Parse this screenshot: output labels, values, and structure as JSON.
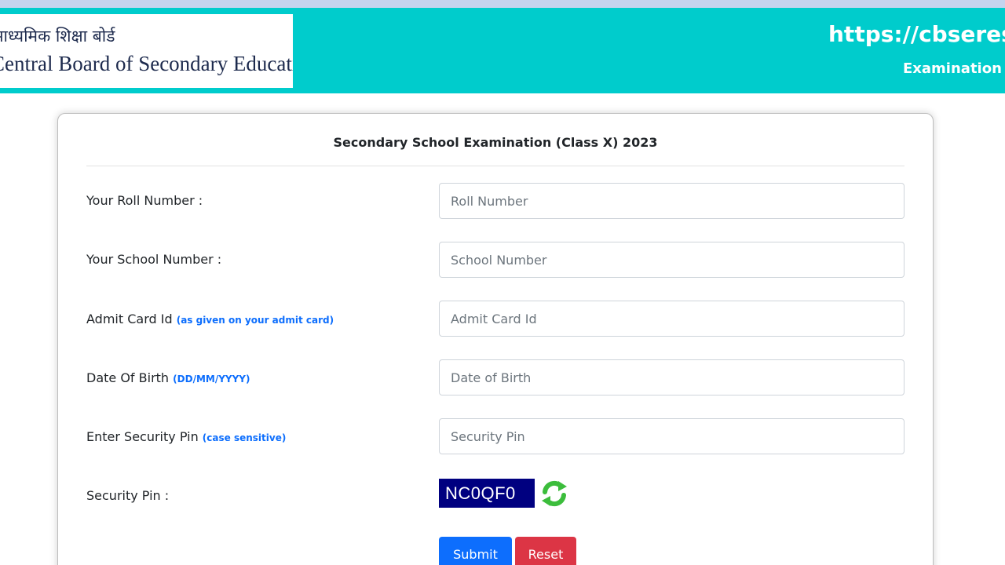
{
  "header": {
    "logo_hindi": "माध्यमिक शिक्षा बोर्ड",
    "logo_english": "Central Board of Secondary Education",
    "site_url": "https://cbseresults.nic.in",
    "site_subtitle": "Examination Results"
  },
  "form": {
    "title": "Secondary School Examination (Class X) 2023",
    "roll": {
      "label": "Your Roll Number :",
      "placeholder": "Roll Number"
    },
    "school": {
      "label": "Your School Number :",
      "placeholder": "School Number"
    },
    "admit": {
      "label": "Admit Card Id",
      "hint": "(as given on your admit card)",
      "placeholder": "Admit Card Id"
    },
    "dob": {
      "label": "Date Of Birth",
      "hint": "(DD/MM/YYYY)",
      "placeholder": "Date of Birth"
    },
    "pin_entry": {
      "label": "Enter Security Pin",
      "hint": "(case sensitive)",
      "placeholder": "Security Pin"
    },
    "pin_display": {
      "label": "Security Pin :",
      "captcha_text": "NC0QF0",
      "refresh_icon": "refresh-icon"
    },
    "submit_label": "Submit",
    "reset_label": "Reset"
  },
  "colors": {
    "header_bg": "#00cccc",
    "top_strip": "#c4d4ee",
    "hint_text": "#0d6efd",
    "captcha_bg": "#000080",
    "submit_bg": "#0d6efd",
    "reset_bg": "#dc3545",
    "refresh_icon": "#3cbd3c"
  }
}
